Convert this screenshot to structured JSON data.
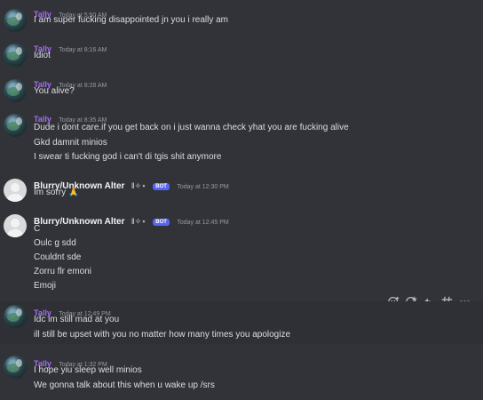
{
  "messages": [
    {
      "author": "Tally",
      "time": "Today at 5:50 AM",
      "lines": [
        "I am super fucking disappointed jn you i really am"
      ]
    },
    {
      "author": "Tally",
      "time": "Today at 8:16 AM",
      "lines": [
        "Idiot"
      ]
    },
    {
      "author": "Tally",
      "time": "Today at 8:28 AM",
      "lines": [
        "You alive?"
      ]
    },
    {
      "author": "Tally",
      "time": "Today at 8:35 AM",
      "lines": [
        "Dude i dont care.if you get back on i just wanna check yhat you are fucking alive",
        "Gkd damnit minios",
        "I swear ti fucking god i can't di tgis shit anymore"
      ]
    },
    {
      "author": "Blurry/Unknown Alter",
      "deco": "‖✧⋆",
      "bot": "BOT",
      "time": "Today at 12:30 PM",
      "lines": [
        "Im sorry 🙏"
      ]
    },
    {
      "author": "Blurry/Unknown Alter",
      "deco": "‖✧⋆",
      "bot": "BOT",
      "time": "Today at 12:45 PM",
      "lines": [
        "C",
        "Oulc g sdd",
        "Couldnt sde",
        "Zorru flr emoni",
        "Emoji"
      ]
    },
    {
      "author": "Tally",
      "time": "Today at 12:49 PM",
      "lines": [
        "Idc im still mad at you",
        "ill still be upset with you no matter how many times you apologize"
      ]
    },
    {
      "author": "Tally",
      "time": "Today at 1:32 PM",
      "lines": [
        "I hope yiu sleep well minios",
        "We gonna talk about this when u wake up /srs"
      ]
    }
  ],
  "toolbar": {
    "icons": [
      "add-reaction-icon",
      "super-reaction-icon",
      "reply-icon",
      "create-thread-icon",
      "more-icon"
    ]
  },
  "colors": {
    "background": "#313338",
    "tally_name": "#a66ef0",
    "bot_badge": "#5865f2",
    "timestamp": "#949ba4",
    "message_text": "#dbdee1"
  }
}
